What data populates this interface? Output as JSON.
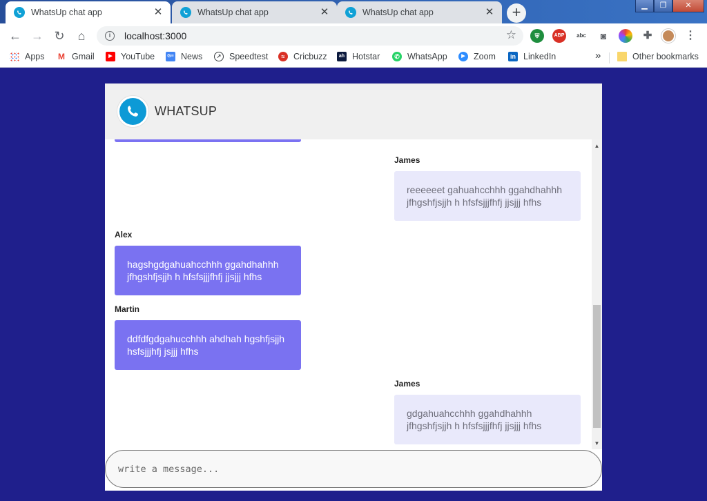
{
  "browser": {
    "tabs": [
      {
        "title": "WhatsUp chat app",
        "active": true
      },
      {
        "title": "WhatsUp chat app",
        "active": false
      },
      {
        "title": "WhatsUp chat app",
        "active": false
      }
    ],
    "url": "localhost:3000",
    "bookmarks": [
      {
        "label": "Apps",
        "icon": "apps-grid-icon",
        "color": "#ea4335"
      },
      {
        "label": "Gmail",
        "icon": "gmail-icon",
        "color": "#ea4335"
      },
      {
        "label": "YouTube",
        "icon": "youtube-icon",
        "color": "#ff0000"
      },
      {
        "label": "News",
        "icon": "google-news-icon",
        "color": "#4285f4"
      },
      {
        "label": "Speedtest",
        "icon": "speedtest-icon",
        "color": "#3c4043"
      },
      {
        "label": "Cricbuzz",
        "icon": "cricbuzz-icon",
        "color": "#d93025"
      },
      {
        "label": "Hotstar",
        "icon": "hotstar-icon",
        "color": "#0c1a3e"
      },
      {
        "label": "WhatsApp",
        "icon": "whatsapp-icon",
        "color": "#25d366"
      },
      {
        "label": "Zoom",
        "icon": "zoom-icon",
        "color": "#2d8cff"
      },
      {
        "label": "LinkedIn",
        "icon": "linkedin-icon",
        "color": "#0a66c2"
      }
    ],
    "other_bookmarks": "Other bookmarks",
    "overflow": "»"
  },
  "app": {
    "brand": "WHATSUP",
    "accent": "#7a72f1",
    "background": "#1f1f8c",
    "messages": [
      {
        "sender": "James",
        "text": "reeeeeet gahuahcchhh ggahdhahhh jfhgshfjsjjh h hfsfsjjjfhfj jjsjjj hfhs",
        "side": "outgoing"
      },
      {
        "sender": "Alex",
        "text": "hagshgdgahuahcchhh ggahdhahhh jfhgshfjsjjh h hfsfsjjjfhfj jjsjjj hfhs",
        "side": "incoming"
      },
      {
        "sender": "Martin",
        "text": "ddfdfgdgahucchhh ahdhah hgshfjsjjh hsfsjjjhfj jsjjj hfhs",
        "side": "incoming"
      },
      {
        "sender": "James",
        "text": "gdgahuahcchhh ggahdhahhh jfhgshfjsjjh h hfsfsjjjfhfj jjsjjj hfhs",
        "side": "outgoing"
      }
    ],
    "input_placeholder": "write a message..."
  }
}
